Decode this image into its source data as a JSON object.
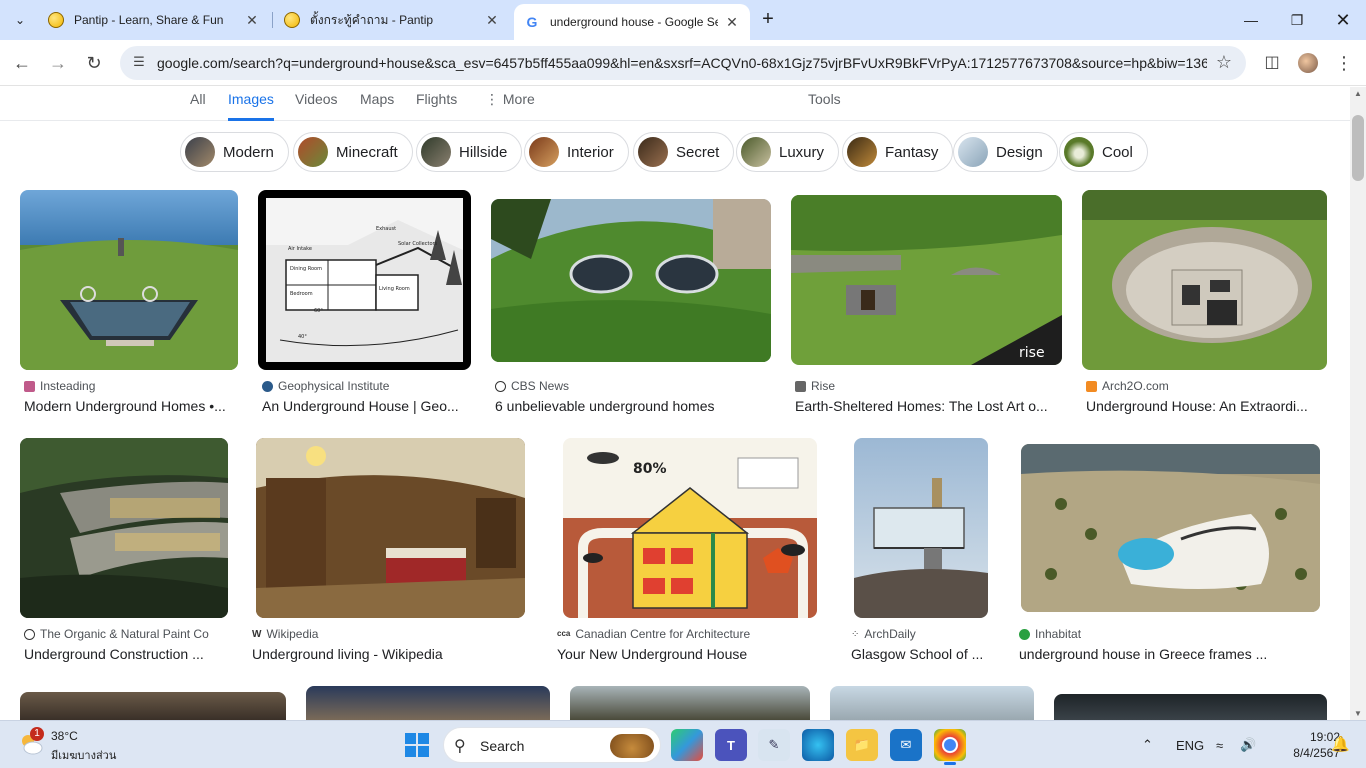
{
  "browser": {
    "tabs": [
      {
        "title": "Pantip - Learn, Share & Fun"
      },
      {
        "title": "ตั้งกระทู้คำถาม - Pantip"
      },
      {
        "title": "underground house - Google Search"
      }
    ],
    "url": "google.com/search?q=underground+house&sca_esv=6457b5ff455aa099&hl=en&sxsrf=ACQVn0-68x1Gjz75vjrBFvUxR9BkFVrPyA:1712577673708&source=hp&biw=136..."
  },
  "search_nav": {
    "all": "All",
    "images": "Images",
    "videos": "Videos",
    "maps": "Maps",
    "flights": "Flights",
    "more": "More",
    "tools": "Tools"
  },
  "chips": [
    {
      "label": "Modern"
    },
    {
      "label": "Minecraft"
    },
    {
      "label": "Hillside"
    },
    {
      "label": "Interior"
    },
    {
      "label": "Secret"
    },
    {
      "label": "Luxury"
    },
    {
      "label": "Fantasy"
    },
    {
      "label": "Design"
    },
    {
      "label": "Cool"
    }
  ],
  "results": [
    {
      "source": "Insteading",
      "title": "Modern Underground Homes •..."
    },
    {
      "source": "Geophysical Institute",
      "title": "An Underground House | Geo..."
    },
    {
      "source": "CBS News",
      "title": "6 unbelievable underground homes"
    },
    {
      "source": "Rise",
      "title": "Earth-Sheltered Homes: The Lost Art o..."
    },
    {
      "source": "Arch2O.com",
      "title": "Underground House: An Extraordi..."
    },
    {
      "source": "The Organic & Natural Paint Co",
      "title": "Underground Construction ..."
    },
    {
      "source": "Wikipedia",
      "title": "Underground living - Wikipedia"
    },
    {
      "source": "Canadian Centre for Architecture",
      "title": "Your New Underground House"
    },
    {
      "source": "ArchDaily",
      "title": "Glasgow School of ..."
    },
    {
      "source": "Inhabitat",
      "title": "underground house in Greece frames ..."
    }
  ],
  "diagram_labels": {
    "cross_section_words": [
      "Air Intake",
      "Exhaust",
      "Solar Collectors",
      "Dining Room",
      "Bedroom",
      "Living Room",
      "60°",
      "40°"
    ],
    "percent": "80%"
  },
  "rise_logo": "rise",
  "taskbar": {
    "weather_badge": "1",
    "temperature": "38°C",
    "weather_desc": "มีเมฆบางส่วน",
    "search_label": "Search",
    "language": "ENG",
    "time": "19:02",
    "date": "8/4/2567"
  },
  "colors": {
    "accent": "#1a73e8",
    "tabstrip": "#d3e3fd",
    "taskbar": "#dde6f3"
  }
}
